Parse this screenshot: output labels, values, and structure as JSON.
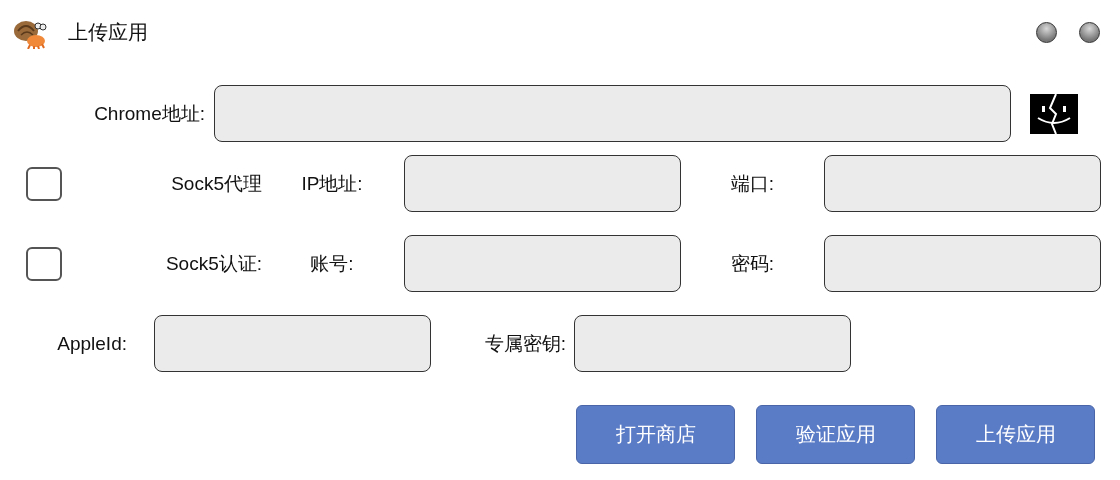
{
  "window": {
    "title": "上传应用"
  },
  "chrome": {
    "label": "Chrome地址:"
  },
  "options": [
    {
      "checked": false,
      "label": "Sock5代理",
      "fields": [
        {
          "label": "IP地址:"
        },
        {
          "label": "端口:"
        }
      ]
    },
    {
      "checked": false,
      "label": "Sock5认证:",
      "fields": [
        {
          "label": "账号:"
        },
        {
          "label": "密码:"
        }
      ]
    }
  ],
  "account": {
    "fields": [
      {
        "label": "AppleId:"
      },
      {
        "label": "专属密钥:"
      }
    ]
  },
  "buttons": [
    "打开商店",
    "验证应用",
    "上传应用"
  ]
}
